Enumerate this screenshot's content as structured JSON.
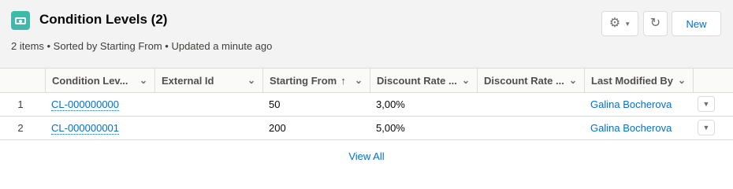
{
  "header": {
    "title": "Condition Levels (2)",
    "subtitle": "2 items • Sorted by Starting From • Updated a minute ago",
    "icon": "condition-level-object-icon",
    "actions": {
      "gear_icon": "gear-icon",
      "refresh_icon": "refresh-icon",
      "new_label": "New"
    }
  },
  "table": {
    "columns": [
      {
        "label": "Condition Lev...",
        "sorted": false
      },
      {
        "label": "External Id",
        "sorted": false
      },
      {
        "label": "Starting From",
        "sorted": true,
        "sort_direction": "asc"
      },
      {
        "label": "Discount Rate ...",
        "sorted": false
      },
      {
        "label": "Discount Rate ...",
        "sorted": false
      },
      {
        "label": "Last Modified By",
        "sorted": false
      }
    ],
    "rows": [
      {
        "num": "1",
        "name": "CL-000000000",
        "external_id": "",
        "starting_from": "50",
        "discount_rate_1": "3,00%",
        "discount_rate_2": "",
        "last_modified_by": "Galina Bocherova"
      },
      {
        "num": "2",
        "name": "CL-000000001",
        "external_id": "",
        "starting_from": "200",
        "discount_rate_1": "5,00%",
        "discount_rate_2": "",
        "last_modified_by": "Galina Bocherova"
      }
    ]
  },
  "footer": {
    "view_all_label": "View All"
  },
  "colors": {
    "brand_link": "#0070d2",
    "object_icon": "#3fb9a9",
    "header_bg": "#f3f3f3",
    "border": "#dddbda"
  }
}
